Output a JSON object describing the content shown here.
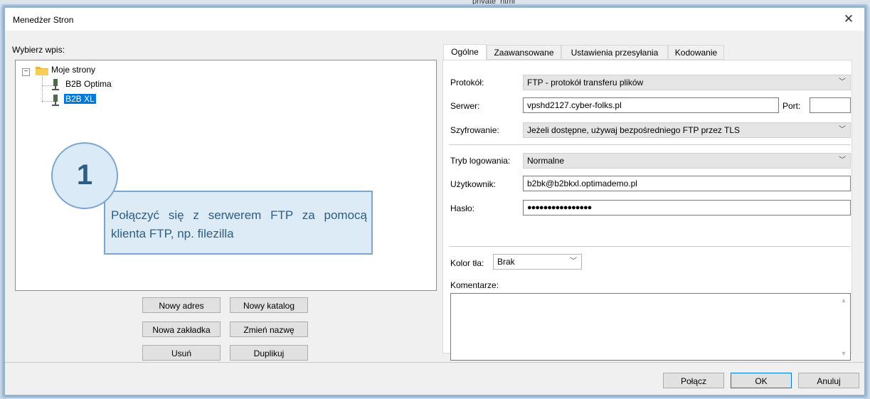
{
  "background": {
    "fragment": "private_html"
  },
  "dialog": {
    "title": "Menedżer Stron",
    "close": "✕"
  },
  "left": {
    "label": "Wybierz wpis:",
    "tree": {
      "root": "Moje strony",
      "items": [
        "B2B Optima",
        "B2B XL"
      ],
      "selected": "B2B XL"
    },
    "buttons": {
      "new_site": "Nowy adres",
      "new_folder": "Nowy katalog",
      "new_bookmark": "Nowa zakładka",
      "rename": "Zmień nazwę",
      "delete": "Usuń",
      "duplicate": "Duplikuj"
    }
  },
  "tabs": [
    "Ogólne",
    "Zaawansowane",
    "Ustawienia przesyłania",
    "Kodowanie"
  ],
  "general": {
    "protocol_label": "Protokół:",
    "protocol_value": "FTP - protokół transferu plików",
    "server_label": "Serwer:",
    "server_value": "vpshd2127.cyber-folks.pl",
    "port_label": "Port:",
    "port_value": "",
    "encryption_label": "Szyfrowanie:",
    "encryption_value": "Jeżeli dostępne, używaj bezpośredniego FTP przez TLS",
    "logon_label": "Tryb logowania:",
    "logon_value": "Normalne",
    "user_label": "Użytkownik:",
    "user_value": "b2bk@b2bkxl.optimademo.pl",
    "password_label": "Hasło:",
    "password_value": "●●●●●●●●●●●●●●●●",
    "bgcolor_label": "Kolor tła:",
    "bgcolor_value": "Brak",
    "comments_label": "Komentarze:"
  },
  "footer": {
    "connect": "Połącz",
    "ok": "OK",
    "cancel": "Anuluj"
  },
  "overlay": {
    "step": "1",
    "text": "Połączyć się z serwerem FTP za pomocą klienta FTP, np. filezilla"
  },
  "colors": {
    "selection": "#0078d7",
    "callout_fill": "#dcebf6",
    "callout_border": "#7aa6cf",
    "callout_text": "#2d5d84"
  }
}
